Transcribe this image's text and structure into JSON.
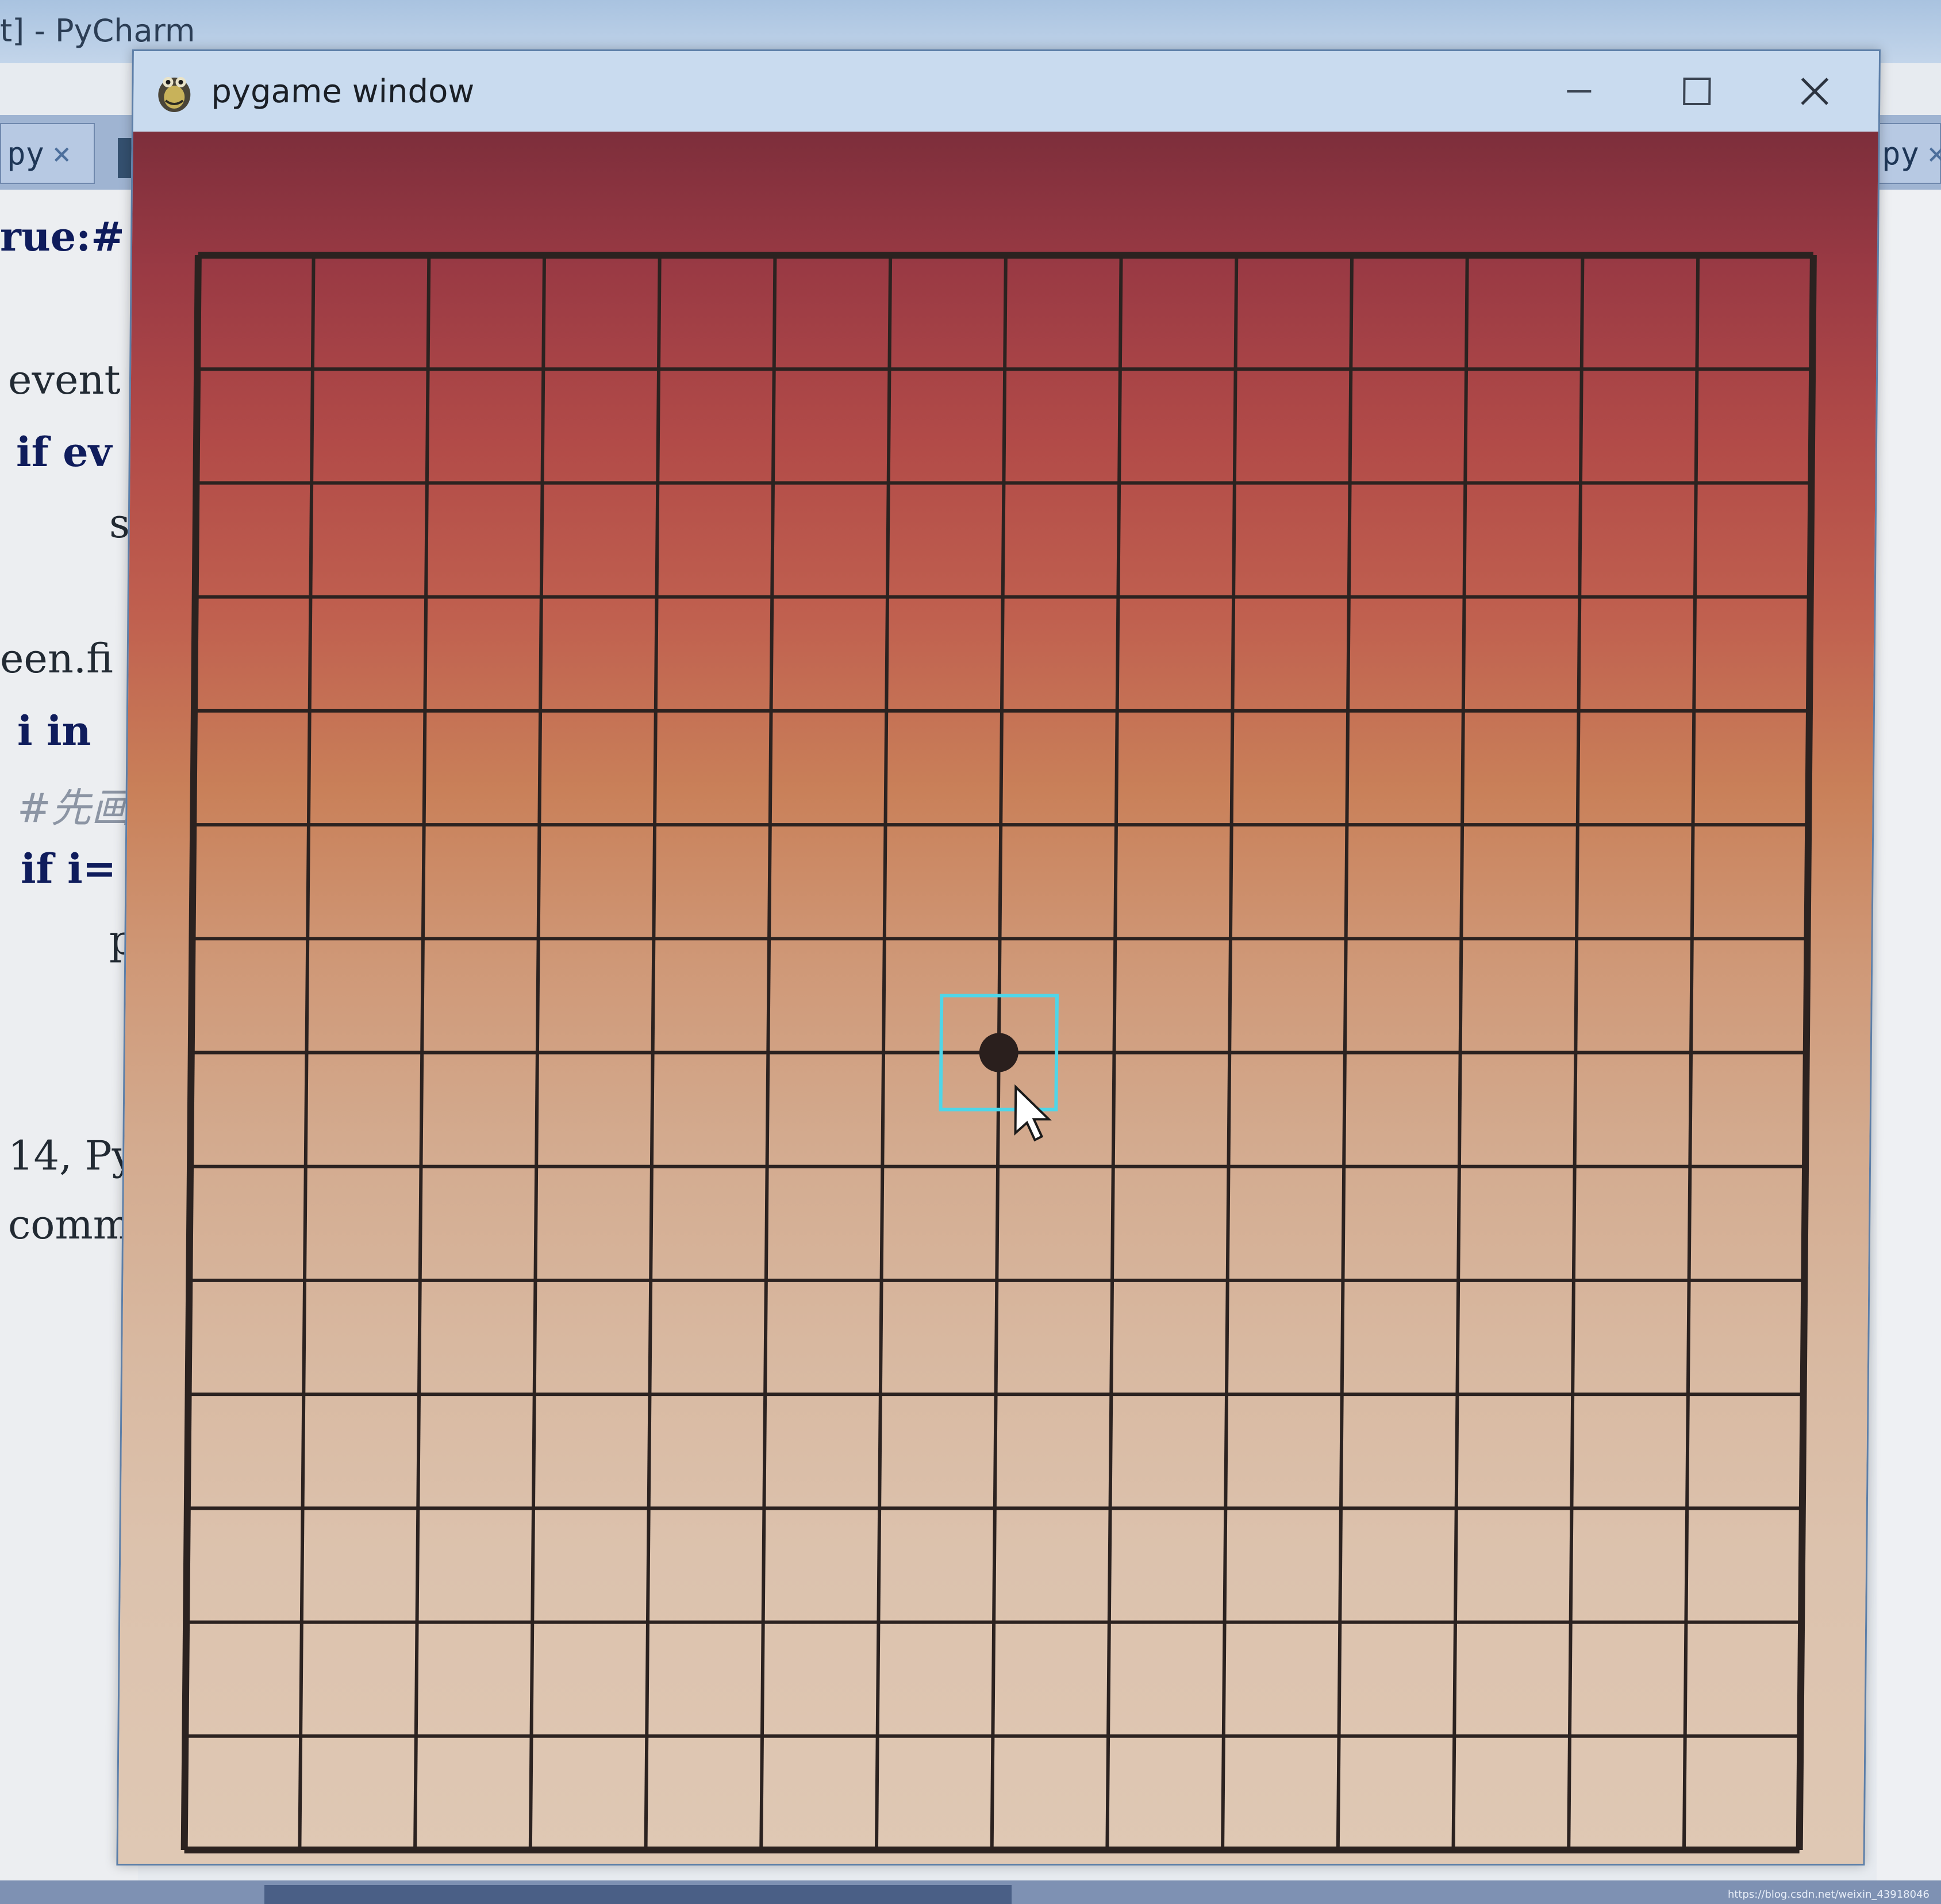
{
  "background_app": {
    "title": "t] - PyCharm",
    "tabs": [
      {
        "label": "py",
        "close": "×"
      },
      {
        "label": "py",
        "close": "×"
      }
    ],
    "code_lines": [
      {
        "text": "rue:#",
        "style": "bold"
      },
      {
        "text": "event",
        "style": "normal"
      },
      {
        "text": "if ev",
        "style": "bold"
      },
      {
        "text": "s",
        "style": "normal"
      },
      {
        "text": "een.fi",
        "style": "normal"
      },
      {
        "text": "i in",
        "style": "bold"
      },
      {
        "text": "#先画",
        "style": "comment"
      },
      {
        "text": "if i=",
        "style": "bold"
      },
      {
        "text": "p",
        "style": "normal"
      },
      {
        "text": "14, Py",
        "style": "normal"
      },
      {
        "text": "commun",
        "style": "normal"
      }
    ],
    "watermark": "https://blog.csdn.net/weixin_43918046"
  },
  "window": {
    "title": "pygame window",
    "icon": "pygame-snake-icon",
    "controls": [
      {
        "name": "minimize-button",
        "icon": "minimize-icon"
      },
      {
        "name": "maximize-button",
        "icon": "maximize-icon"
      },
      {
        "name": "close-button",
        "icon": "close-icon"
      }
    ]
  },
  "board": {
    "lines": 15,
    "cells": 14,
    "line_color": "#2b2220",
    "gradient_top": "#7d2e3b",
    "gradient_bottom": "#dfc8b4",
    "stones": [
      {
        "color": "black",
        "col": 7,
        "row": 7
      }
    ],
    "cursor_highlight": {
      "col": 7,
      "row": 7,
      "color": "#4fd6e8"
    }
  }
}
